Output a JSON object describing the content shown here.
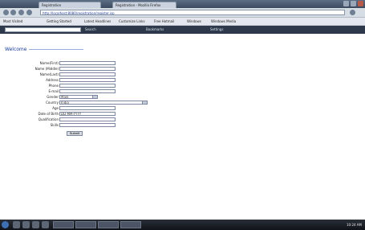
{
  "browser": {
    "tabs": [
      "Registration",
      "Registration - Mozilla Firefox"
    ],
    "address": "http://localhost:8080/registration/register.jsp",
    "bookmarks": [
      "Most Visited",
      "Getting Started",
      "Latest Headlines",
      "Customize Links",
      "Free Hotmail",
      "Windows",
      "Windows Media"
    ],
    "toolbar_items": [
      "Search",
      "Bookmarks",
      "Settings"
    ]
  },
  "page": {
    "heading": "Welcome",
    "form": {
      "fields": [
        {
          "label": "Name(First)",
          "value": ""
        },
        {
          "label": "Name (Middle)",
          "value": ""
        },
        {
          "label": "Name(Last)",
          "value": ""
        },
        {
          "label": "Address",
          "value": ""
        },
        {
          "label": "Phone",
          "value": ""
        },
        {
          "label": "E-mail",
          "value": ""
        },
        {
          "label": "Gender",
          "value": "Male",
          "type": "select"
        },
        {
          "label": "Country",
          "value": "India",
          "type": "select"
        },
        {
          "label": "Age",
          "value": ""
        },
        {
          "label": "Date of Birth",
          "value": "DD-MM-YYYY"
        },
        {
          "label": "Qualification",
          "value": ""
        },
        {
          "label": "Skills",
          "value": ""
        }
      ],
      "submit_label": "Submit"
    }
  },
  "taskbar": {
    "clock": "10:24 AM"
  }
}
